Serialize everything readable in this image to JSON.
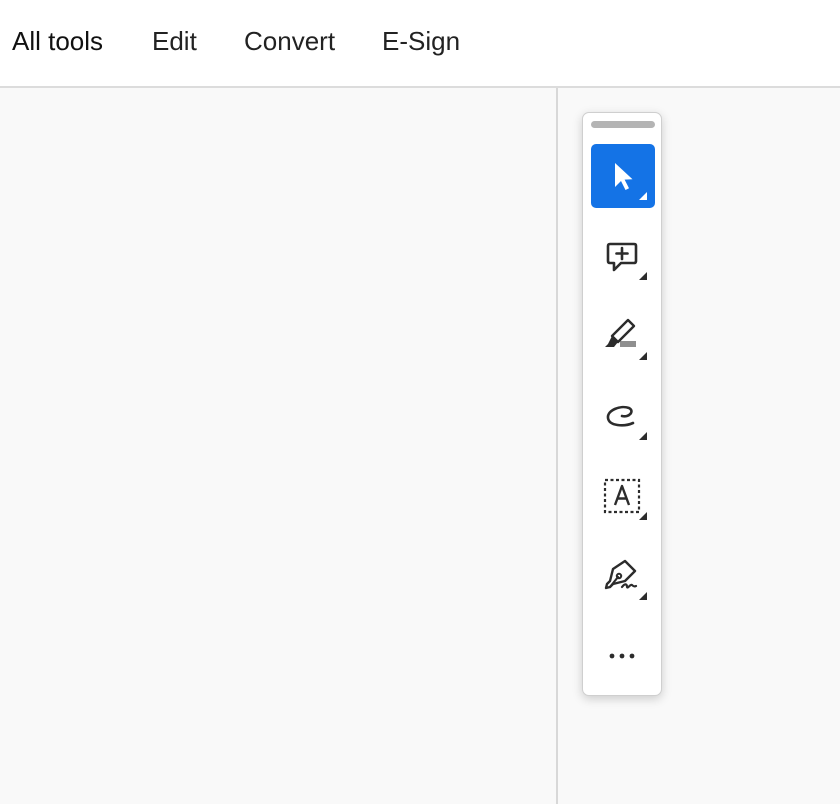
{
  "menu": {
    "items": [
      {
        "label": "All tools"
      },
      {
        "label": "Edit"
      },
      {
        "label": "Convert"
      },
      {
        "label": "E-Sign"
      }
    ]
  },
  "toolbar": {
    "tools": [
      {
        "icon": "select-cursor-icon",
        "selected": true
      },
      {
        "icon": "add-comment-icon",
        "selected": false
      },
      {
        "icon": "highlight-marker-icon",
        "selected": false
      },
      {
        "icon": "freehand-draw-icon",
        "selected": false
      },
      {
        "icon": "text-box-icon",
        "selected": false
      },
      {
        "icon": "sign-pen-icon",
        "selected": false
      },
      {
        "icon": "more-options-icon",
        "selected": false
      }
    ]
  },
  "colors": {
    "accent": "#1473e6",
    "panel_background": "#f9f9f9",
    "icon": "#2c2c2c"
  }
}
